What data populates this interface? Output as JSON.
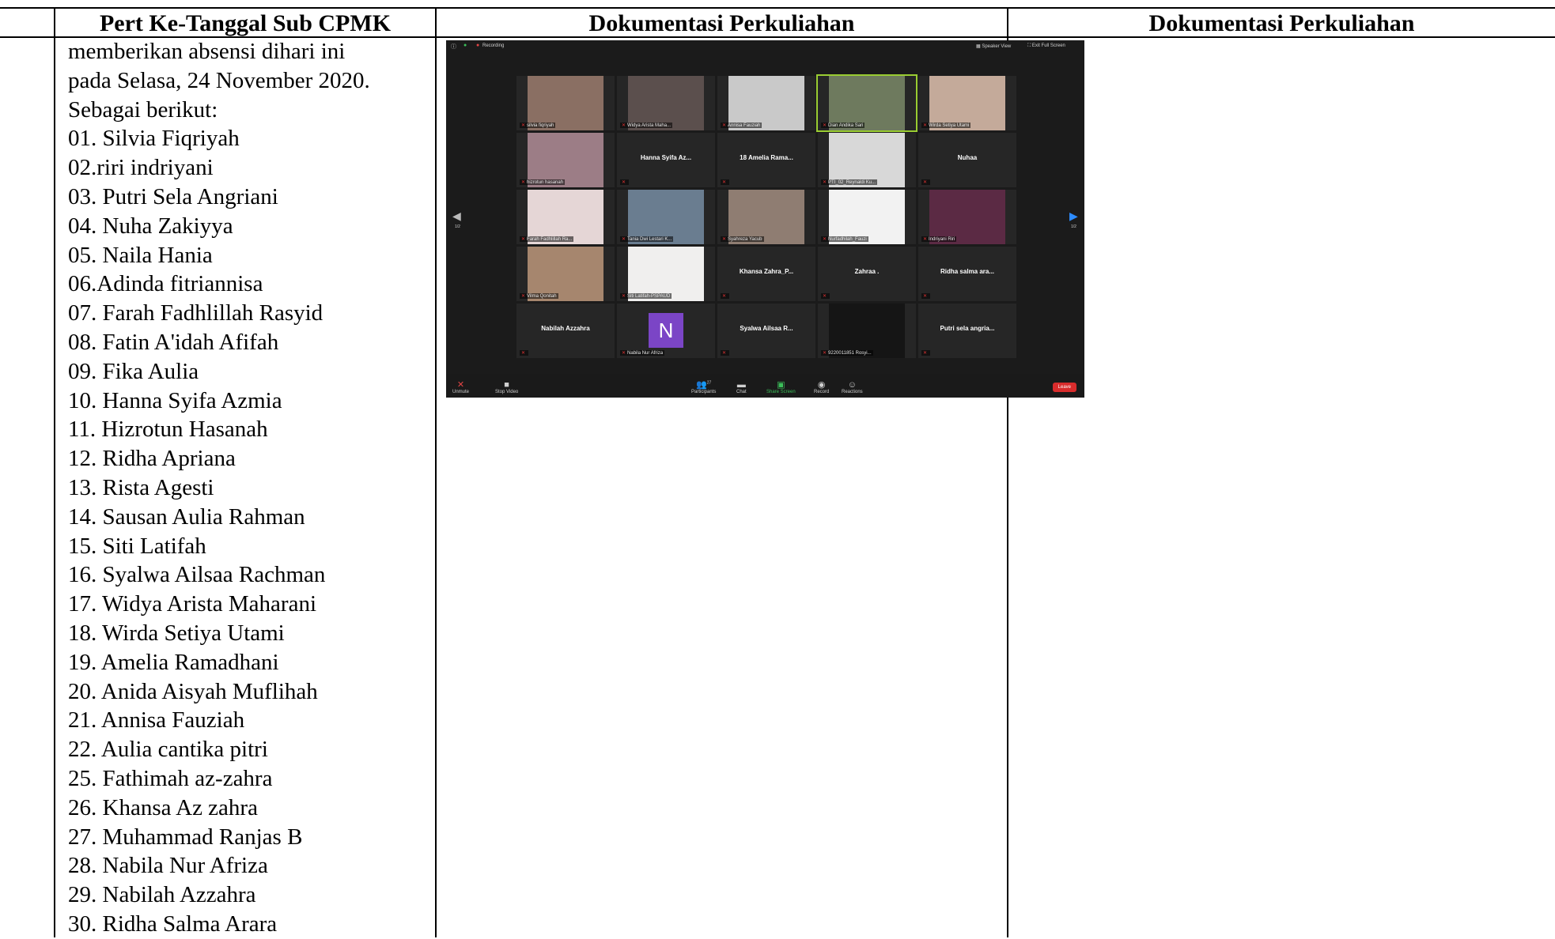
{
  "table": {
    "headers": [
      "Pert Ke-Tanggal Sub CPMK",
      "Dokumentasi Perkuliahan",
      "Dokumentasi Perkuliahan"
    ],
    "intro_lines": [
      "memberikan absensi dihari ini",
      "pada Selasa, 24 November 2020.",
      "Sebagai berikut:"
    ],
    "attendance": [
      "01. Silvia Fiqriyah",
      "02.riri indriyani",
      "03. Putri Sela Angriani",
      "04. Nuha Zakiyya",
      "05. Naila Hania",
      "06.Adinda fitriannisa",
      "07. Farah Fadhlillah Rasyid",
      "08. Fatin A'idah Afifah",
      "09. Fika Aulia",
      "10. Hanna Syifa Azmia",
      "11. Hizrotun Hasanah",
      "12. Ridha Apriana",
      "13. Rista Agesti",
      "14. Sausan Aulia Rahman",
      "15. Siti Latifah",
      "16. Syalwa Ailsaa Rachman",
      "17. Widya Arista Maharani",
      "18. Wirda Setiya Utami",
      "19. Amelia Ramadhani",
      "20. Anida Aisyah Muflihah",
      "21. Annisa Fauziah",
      "22. Aulia cantika pitri",
      "25. Fathimah az-zahra",
      "26. Khansa Az zahra",
      "27. Muhammad Ranjas B",
      "28. Nabila Nur Afriza",
      "29. Nabilah Azzahra",
      "30. Ridha Salma Arara"
    ]
  },
  "zoom": {
    "recording": "Recording",
    "speaker_view": "Speaker View",
    "exit_full_screen": "Exit Full Screen",
    "page_left": "1/2",
    "page_right": "1/2",
    "tiles": [
      {
        "label": "silvia fiqriyah",
        "name": "",
        "video": true,
        "color": "#8a6f63"
      },
      {
        "label": "Widya Arista Maha...",
        "name": "",
        "video": true,
        "color": "#5b4f4d"
      },
      {
        "label": "Annisa Fauziah",
        "name": "",
        "video": true,
        "color": "#c9c9c9"
      },
      {
        "label": "Dian Andika Sari",
        "name": "",
        "video": true,
        "color": "#6e7a5e"
      },
      {
        "label": "Wirda Setiya Utami",
        "name": "",
        "video": true,
        "color": "#c4aa9a"
      },
      {
        "label": "hizrotun hasanah",
        "name": "",
        "video": true,
        "color": "#9c7d86"
      },
      {
        "label": "",
        "name": "Hanna Syifa Az...",
        "video": false,
        "color": "#262626"
      },
      {
        "label": "",
        "name": "18 Amelia Rama...",
        "video": false,
        "color": "#262626"
      },
      {
        "label": "PTI_02_Reynaldi Ku...",
        "name": "",
        "video": true,
        "color": "#d8d8d8"
      },
      {
        "label": "",
        "name": "Nuhaa",
        "video": false,
        "color": "#262626"
      },
      {
        "label": "Farah Fadhlillah Ra...",
        "name": "",
        "video": true,
        "color": "#e5d6d6"
      },
      {
        "label": "Tania Dwi Lestari K...",
        "name": "",
        "video": true,
        "color": "#6a7d90"
      },
      {
        "label": "Syahreza Yacub",
        "name": "",
        "video": true,
        "color": "#8f7d72"
      },
      {
        "label": "Nurfadhilah_Fauzi",
        "name": "",
        "video": true,
        "color": "#f2f2f2"
      },
      {
        "label": "Indriyani Riri",
        "name": "",
        "video": true,
        "color": "#5b2a44"
      },
      {
        "label": "Vilma Qonitah",
        "name": "",
        "video": true,
        "color": "#a6866e"
      },
      {
        "label": "Siti Latifah-PSPAUD",
        "name": "",
        "video": true,
        "color": "#f0efee"
      },
      {
        "label": "",
        "name": "Khansa Zahra_P...",
        "video": false,
        "color": "#262626"
      },
      {
        "label": "",
        "name": "Zahraa .",
        "video": false,
        "color": "#262626"
      },
      {
        "label": "",
        "name": "Ridha salma ara...",
        "video": false,
        "color": "#262626"
      },
      {
        "label": "",
        "name": "Nabilah Azzahra",
        "video": false,
        "color": "#262626"
      },
      {
        "label": "Nabila Nur Afriza",
        "name": "N",
        "video": false,
        "color": "#262626",
        "avatar": true
      },
      {
        "label": "",
        "name": "Syalwa Ailsaa R...",
        "video": false,
        "color": "#262626"
      },
      {
        "label": "9220011851 Rosyi...",
        "name": "",
        "video": true,
        "color": "#151515"
      },
      {
        "label": "",
        "name": "Putri sela angria...",
        "video": false,
        "color": "#262626"
      }
    ],
    "toolbar": {
      "unmute": "Unmute",
      "stop_video": "Stop Video",
      "participants": "Participants",
      "participants_count": "27",
      "chat": "Chat",
      "share_screen": "Share Screen",
      "record": "Record",
      "reactions": "Reactions",
      "leave": "Leave"
    }
  }
}
